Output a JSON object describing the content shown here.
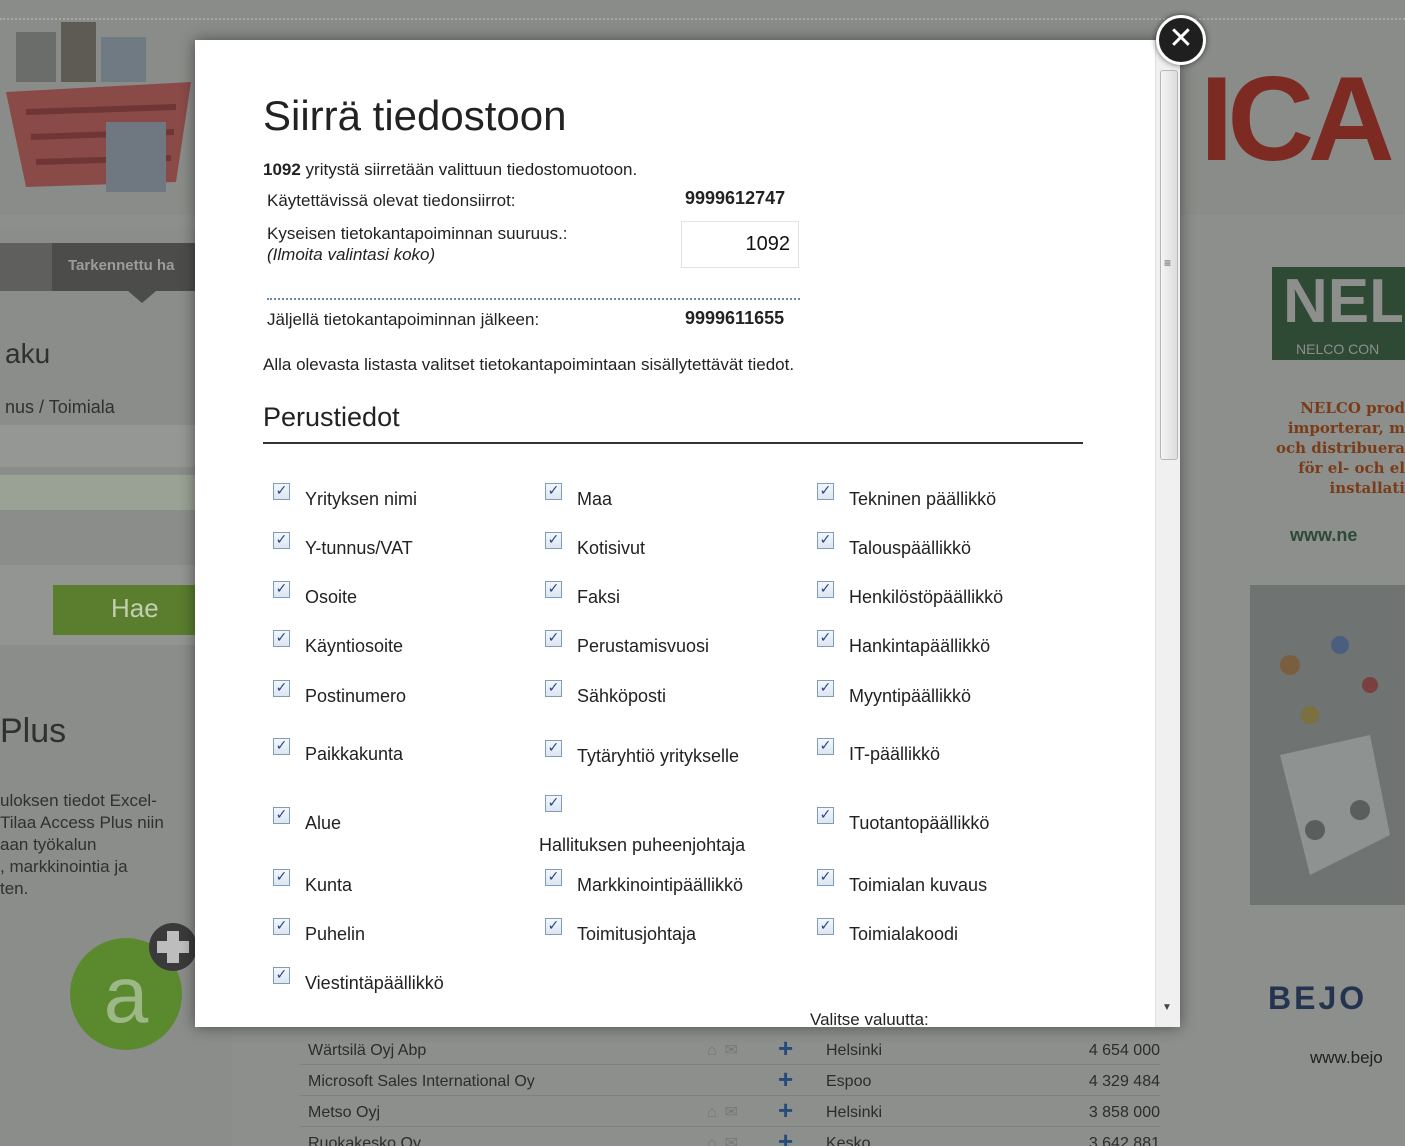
{
  "background": {
    "left_tab": "Tarkennettu ha",
    "heading": "aku",
    "breadcrumb": "nus / Toimiala",
    "search_button": "Hae",
    "plus_heading": "Plus",
    "promo_lines": "uloksen tiedot Excel-\nTilaa Access Plus niin\naan työkalun\n, markkinointia ja\nten.",
    "ica_logo": "ICA",
    "nelco_logo": "NEL",
    "nelco_sub": "NELCO CON",
    "nelco_text": "NELCO prod\nimporterar, m\noch distribuera\nför el- och el\ninstallati",
    "nelco_url": "www.ne",
    "bejo_logo": "BEJO",
    "bejo_url": "www.bejo",
    "table": [
      {
        "name": "Wärtsilä Oyj Abp",
        "city": "Helsinki",
        "value": "4 654 000"
      },
      {
        "name": "Microsoft Sales International Oy",
        "city": "Espoo",
        "value": "4 329 484"
      },
      {
        "name": "Metso Oyj",
        "city": "Helsinki",
        "value": "3 858 000"
      },
      {
        "name": "Ruokakesko Oy",
        "city": "Kesko",
        "value": "3 642 881"
      }
    ]
  },
  "modal": {
    "title": "Siirrä tiedostoon",
    "summary_count": "1092",
    "summary_text": " yritystä siirretään valittuun tiedostomuotoon.",
    "available_label": "Käytettävissä olevat tiedonsiirrot:",
    "available_value": "9999612747",
    "size_label": "Kyseisen tietokantapoiminnan suuruus.:",
    "size_hint": "(Ilmoita valintasi koko)",
    "size_value": "1092",
    "remaining_label": "Jäljellä tietokantapoiminnan jälkeen:",
    "remaining_value": "9999611655",
    "info": "Alla olevasta listasta valitset tietokantapoimintaan sisällytettävät tiedot.",
    "section": "Perustiedot",
    "currency_label": "Valitse valuutta:",
    "close_glyph": "✕",
    "check_glyph": "✓",
    "fields": [
      {
        "label": "Yrityksen nimi",
        "checked": true
      },
      {
        "label": "Y-tunnus/VAT",
        "checked": true
      },
      {
        "label": "Osoite",
        "checked": true
      },
      {
        "label": "Käyntiosoite",
        "checked": true
      },
      {
        "label": "Postinumero",
        "checked": true
      },
      {
        "label": "Paikkakunta",
        "checked": true
      },
      {
        "label": "Alue",
        "checked": true
      },
      {
        "label": "Kunta",
        "checked": true
      },
      {
        "label": "Puhelin",
        "checked": true
      },
      {
        "label": "Viestintäpäällikkö",
        "checked": true
      },
      {
        "label": "Maa",
        "checked": true
      },
      {
        "label": "Kotisivut",
        "checked": true
      },
      {
        "label": "Faksi",
        "checked": true
      },
      {
        "label": "Perustamisvuosi",
        "checked": true
      },
      {
        "label": "Sähköposti",
        "checked": true
      },
      {
        "label": "Tytäryhtiö yritykselle",
        "checked": true
      },
      {
        "label": "Hallituksen puheenjohtaja",
        "checked": true
      },
      {
        "label": "Markkinointipäällikkö",
        "checked": true
      },
      {
        "label": "Toimitusjohtaja",
        "checked": true
      },
      {
        "label": "Tekninen päällikkö",
        "checked": true
      },
      {
        "label": "Talouspäällikkö",
        "checked": true
      },
      {
        "label": "Henkilöstöpäällikkö",
        "checked": true
      },
      {
        "label": "Hankintapäällikkö",
        "checked": true
      },
      {
        "label": "Myyntipäällikkö",
        "checked": true
      },
      {
        "label": "IT-päällikkö",
        "checked": true
      },
      {
        "label": "Tuotantopäällikkö",
        "checked": true
      },
      {
        "label": "Toimialan kuvaus",
        "checked": true
      },
      {
        "label": "Toimialakoodi",
        "checked": true
      }
    ]
  }
}
